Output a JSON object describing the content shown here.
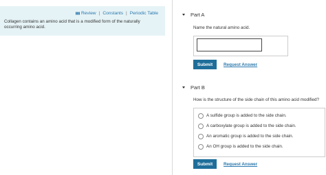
{
  "toolbar": {
    "review_label": "Review",
    "constants_label": "Constants",
    "periodic_table_label": "Periodic Table",
    "separator": "|",
    "review_icon": "review-bars-icon"
  },
  "problem": {
    "text": "Collagen contains an amino acid that is a modified form of the naturally occurring amino acid."
  },
  "part_a": {
    "title": "Part A",
    "question": "Name the natural amino acid.",
    "answer_value": "",
    "submit_label": "Submit",
    "request_answer_label": "Request Answer"
  },
  "part_b": {
    "title": "Part B",
    "question": "How is the structure of the side chain of this amino acid modified?",
    "options": [
      "A sulfide group is added to the side chain.",
      "A carboxylate group is added to the side chain.",
      "An aromatic group is added to the side chain.",
      "An OH group is added to the side chain."
    ],
    "submit_label": "Submit",
    "request_answer_label": "Request Answer"
  },
  "colors": {
    "accent": "#1f6e9a",
    "link": "#2a78ad",
    "info_panel": "#e6f3f6"
  }
}
